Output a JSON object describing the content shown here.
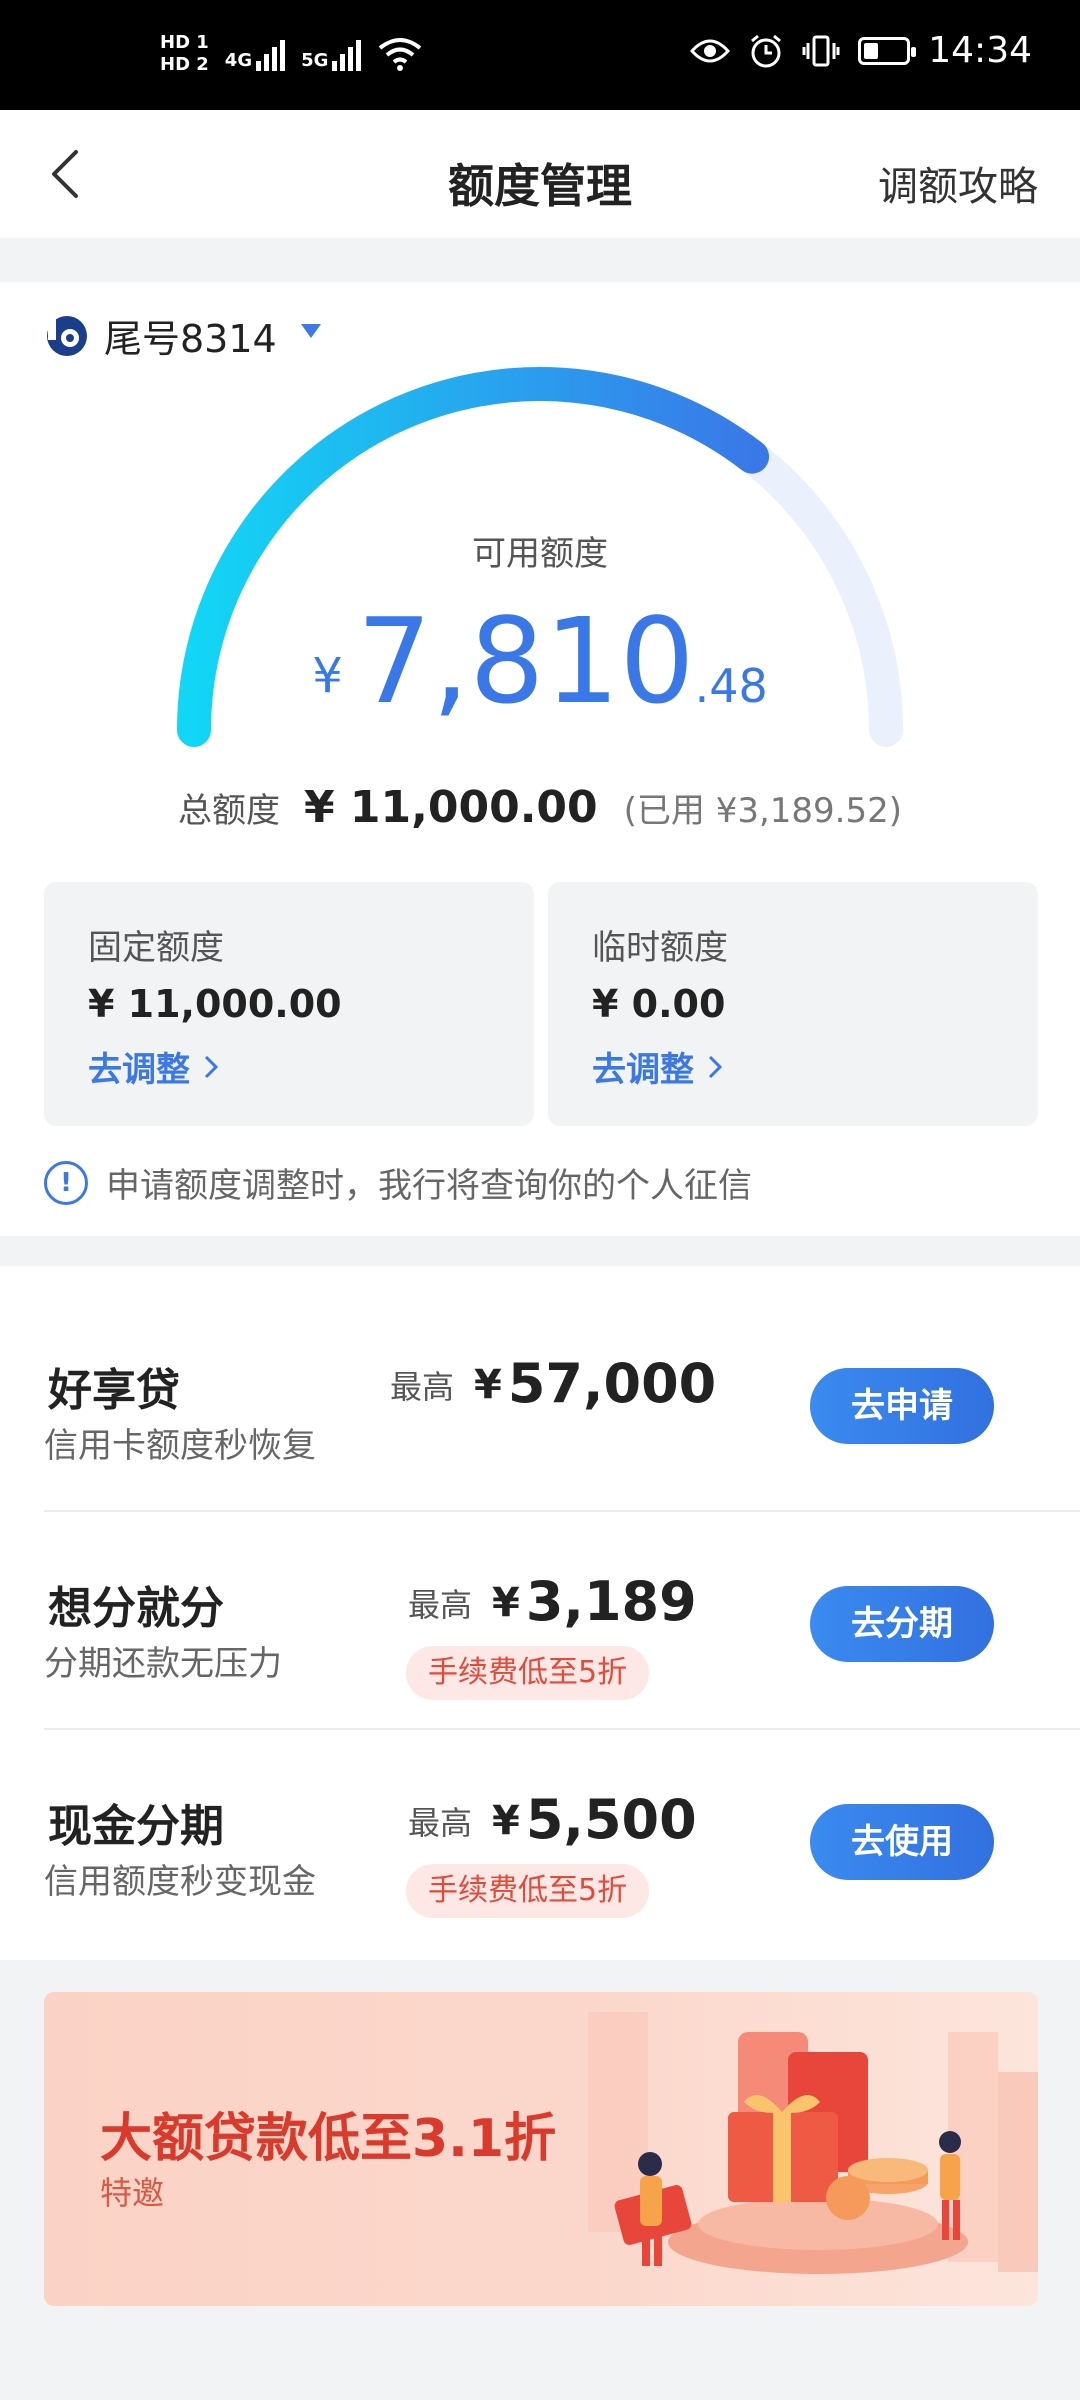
{
  "status_bar": {
    "hd1": "HD 1",
    "hd2": "HD 2",
    "net1": "4G",
    "net2": "5G",
    "time": "14:34"
  },
  "nav": {
    "title": "额度管理",
    "right_link": "调额攻略"
  },
  "account": {
    "label": "尾号8314"
  },
  "limit": {
    "available_label": "可用额度",
    "currency": "¥",
    "available_int": "7,810",
    "available_dec": ".48",
    "used_fraction": 0.29,
    "total_label": "总额度",
    "total_value": "¥ 11,000.00",
    "used_text": "(已用 ¥3,189.52)"
  },
  "boxes": [
    {
      "label": "固定额度",
      "value": "¥ 11,000.00",
      "action": "去调整"
    },
    {
      "label": "临时额度",
      "value": "¥ 0.00",
      "action": "去调整"
    }
  ],
  "notice": "申请额度调整时，我行将查询你的个人征信",
  "products": [
    {
      "name": "好享贷",
      "desc": "信用卡额度秒恢复",
      "max_label": "最高",
      "currency": "¥",
      "amount": "57,000",
      "tag": "",
      "button": "去申请"
    },
    {
      "name": "想分就分",
      "desc": "分期还款无压力",
      "max_label": "最高",
      "currency": "¥",
      "amount": "3,189",
      "tag": "手续费低至5折",
      "button": "去分期"
    },
    {
      "name": "现金分期",
      "desc": "信用额度秒变现金",
      "max_label": "最高",
      "currency": "¥",
      "amount": "5,500",
      "tag": "手续费低至5折",
      "button": "去使用"
    }
  ],
  "banner": {
    "title": "大额贷款低至3.1折",
    "subtitle": "特邀"
  },
  "colors": {
    "accent": "#3a78e8",
    "gauge_start": "#12d6f5",
    "gauge_end": "#3a78e8",
    "gauge_track": "#eaf1fd",
    "tag_text": "#e24a3a"
  }
}
